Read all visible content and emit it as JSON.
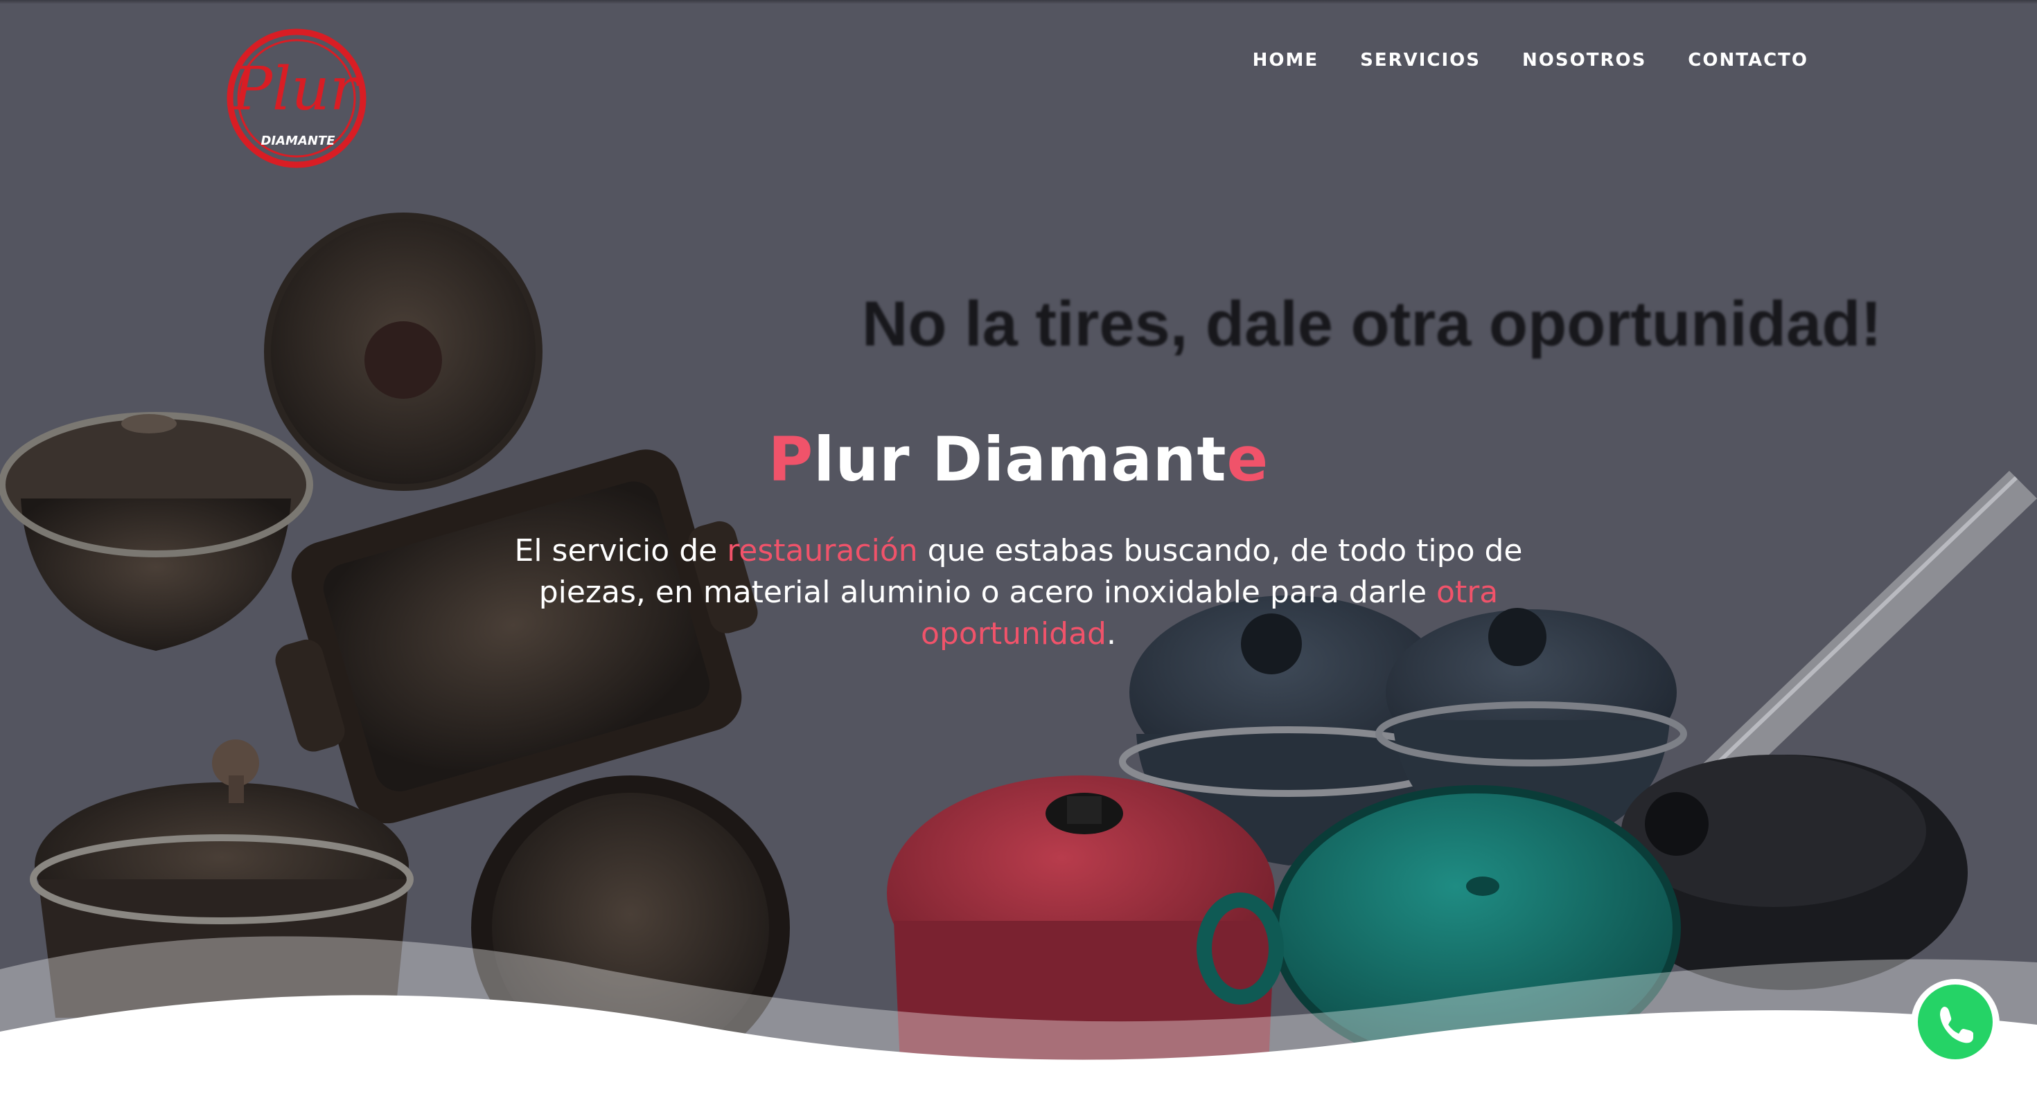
{
  "brand": {
    "logo_script": "Plur",
    "logo_sub": "DIAMANTE",
    "logo_color": "#d91d24"
  },
  "nav": {
    "items": [
      "HOME",
      "SERVICIOS",
      "NOSOTROS",
      "CONTACTO"
    ]
  },
  "hero": {
    "tagline": "No la tires, dale otra oportunidad!",
    "title": {
      "first_letter": "P",
      "middle": "lur Diamant",
      "last_letter": "e"
    },
    "description": {
      "part1": "El servicio de ",
      "highlight1": "restauración",
      "part2": " que estabas buscando, de todo tipo de piezas, en material aluminio o acero inoxidable para darle ",
      "highlight2": "otra oportunidad",
      "part3": "."
    },
    "accent_color": "#f0536a"
  },
  "whatsapp": {
    "icon": "whatsapp-icon",
    "color": "#25d366"
  }
}
